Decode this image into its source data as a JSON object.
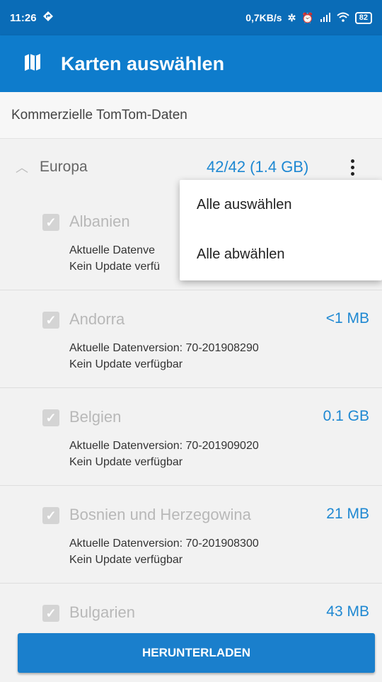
{
  "status_bar": {
    "time": "11:26",
    "network_speed": "0,7KB/s",
    "battery": "82"
  },
  "app_bar": {
    "title": "Karten auswählen"
  },
  "subheader": {
    "text": "Kommerzielle TomTom-Daten"
  },
  "section": {
    "name": "Europa",
    "summary": "42/42 (1.4 GB)"
  },
  "items": [
    {
      "name": "Albanien",
      "size": "",
      "line1": "Aktuelle Datenve",
      "line2": "Kein Update verfü",
      "checked": true
    },
    {
      "name": "Andorra",
      "size": "<1 MB",
      "line1": "Aktuelle Datenversion: 70-201908290",
      "line2": "Kein Update verfügbar",
      "checked": true
    },
    {
      "name": "Belgien",
      "size": "0.1 GB",
      "line1": "Aktuelle Datenversion: 70-201909020",
      "line2": "Kein Update verfügbar",
      "checked": true
    },
    {
      "name": "Bosnien und Herzegowina",
      "size": "21 MB",
      "line1": "Aktuelle Datenversion: 70-201908300",
      "line2": "Kein Update verfügbar",
      "checked": true
    },
    {
      "name": "Bulgarien",
      "size": "43 MB",
      "line1": "",
      "line2": "",
      "checked": true
    }
  ],
  "popup_menu": {
    "select_all": "Alle auswählen",
    "deselect_all": "Alle abwählen"
  },
  "download_button": {
    "label": "HERUNTERLADEN"
  },
  "colors": {
    "status_bar": "#0a6cb7",
    "app_bar": "#0e7ccc",
    "accent": "#1e88d2",
    "button": "#1a7fcc"
  }
}
